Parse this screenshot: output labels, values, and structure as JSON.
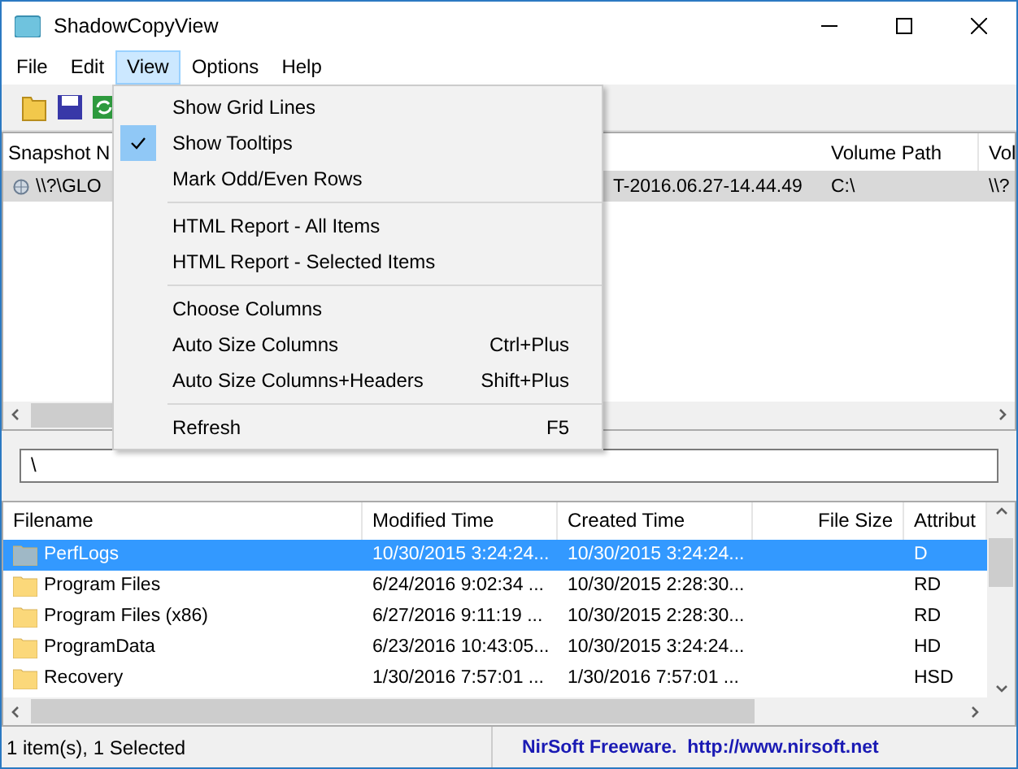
{
  "window": {
    "title": "ShadowCopyView"
  },
  "menubar": [
    {
      "label": "File",
      "selected": false
    },
    {
      "label": "Edit",
      "selected": false
    },
    {
      "label": "View",
      "selected": true
    },
    {
      "label": "Options",
      "selected": false
    },
    {
      "label": "Help",
      "selected": false
    }
  ],
  "view_menu": [
    {
      "kind": "item",
      "label": "Show Grid Lines",
      "checked": false
    },
    {
      "kind": "item",
      "label": "Show Tooltips",
      "checked": true
    },
    {
      "kind": "item",
      "label": "Mark Odd/Even Rows",
      "checked": false
    },
    {
      "kind": "separator"
    },
    {
      "kind": "item",
      "label": "HTML Report - All Items",
      "checked": false
    },
    {
      "kind": "item",
      "label": "HTML Report - Selected Items",
      "checked": false
    },
    {
      "kind": "separator"
    },
    {
      "kind": "item",
      "label": "Choose Columns",
      "checked": false
    },
    {
      "kind": "item",
      "label": "Auto Size Columns",
      "shortcut": "Ctrl+Plus",
      "checked": false
    },
    {
      "kind": "item",
      "label": "Auto Size Columns+Headers",
      "shortcut": "Shift+Plus",
      "checked": false
    },
    {
      "kind": "separator"
    },
    {
      "kind": "item",
      "label": "Refresh",
      "shortcut": "F5",
      "checked": false
    }
  ],
  "snapshot_list": {
    "columns": [
      "Snapshot N",
      "",
      "Volume Path",
      "Vol"
    ],
    "rows": [
      {
        "selected": true,
        "cells": [
          "\\\\?\\GLO",
          "T-2016.06.27-14.44.49",
          "C:\\",
          "\\\\?"
        ]
      }
    ]
  },
  "path_field": {
    "value": "\\"
  },
  "file_list": {
    "columns": [
      "Filename",
      "Modified Time",
      "Created Time",
      "File Size",
      "Attribut"
    ],
    "rows": [
      {
        "selected": true,
        "cells": [
          "PerfLogs",
          "10/30/2015 3:24:24...",
          "10/30/2015 3:24:24...",
          "",
          "D"
        ]
      },
      {
        "selected": false,
        "cells": [
          "Program Files",
          "6/24/2016 9:02:34 ...",
          "10/30/2015 2:28:30...",
          "",
          "RD"
        ]
      },
      {
        "selected": false,
        "cells": [
          "Program Files (x86)",
          "6/27/2016 9:11:19 ...",
          "10/30/2015 2:28:30...",
          "",
          "RD"
        ]
      },
      {
        "selected": false,
        "cells": [
          "ProgramData",
          "6/23/2016 10:43:05...",
          "10/30/2015 3:24:24...",
          "",
          "HD"
        ]
      },
      {
        "selected": false,
        "cells": [
          "Recovery",
          "1/30/2016 7:57:01 ...",
          "1/30/2016 7:57:01 ...",
          "",
          "HSD"
        ]
      }
    ]
  },
  "status_bar": {
    "count": "1 item(s), 1 Selected",
    "credit": "NirSoft Freeware.  http://www.nirsoft.net"
  }
}
